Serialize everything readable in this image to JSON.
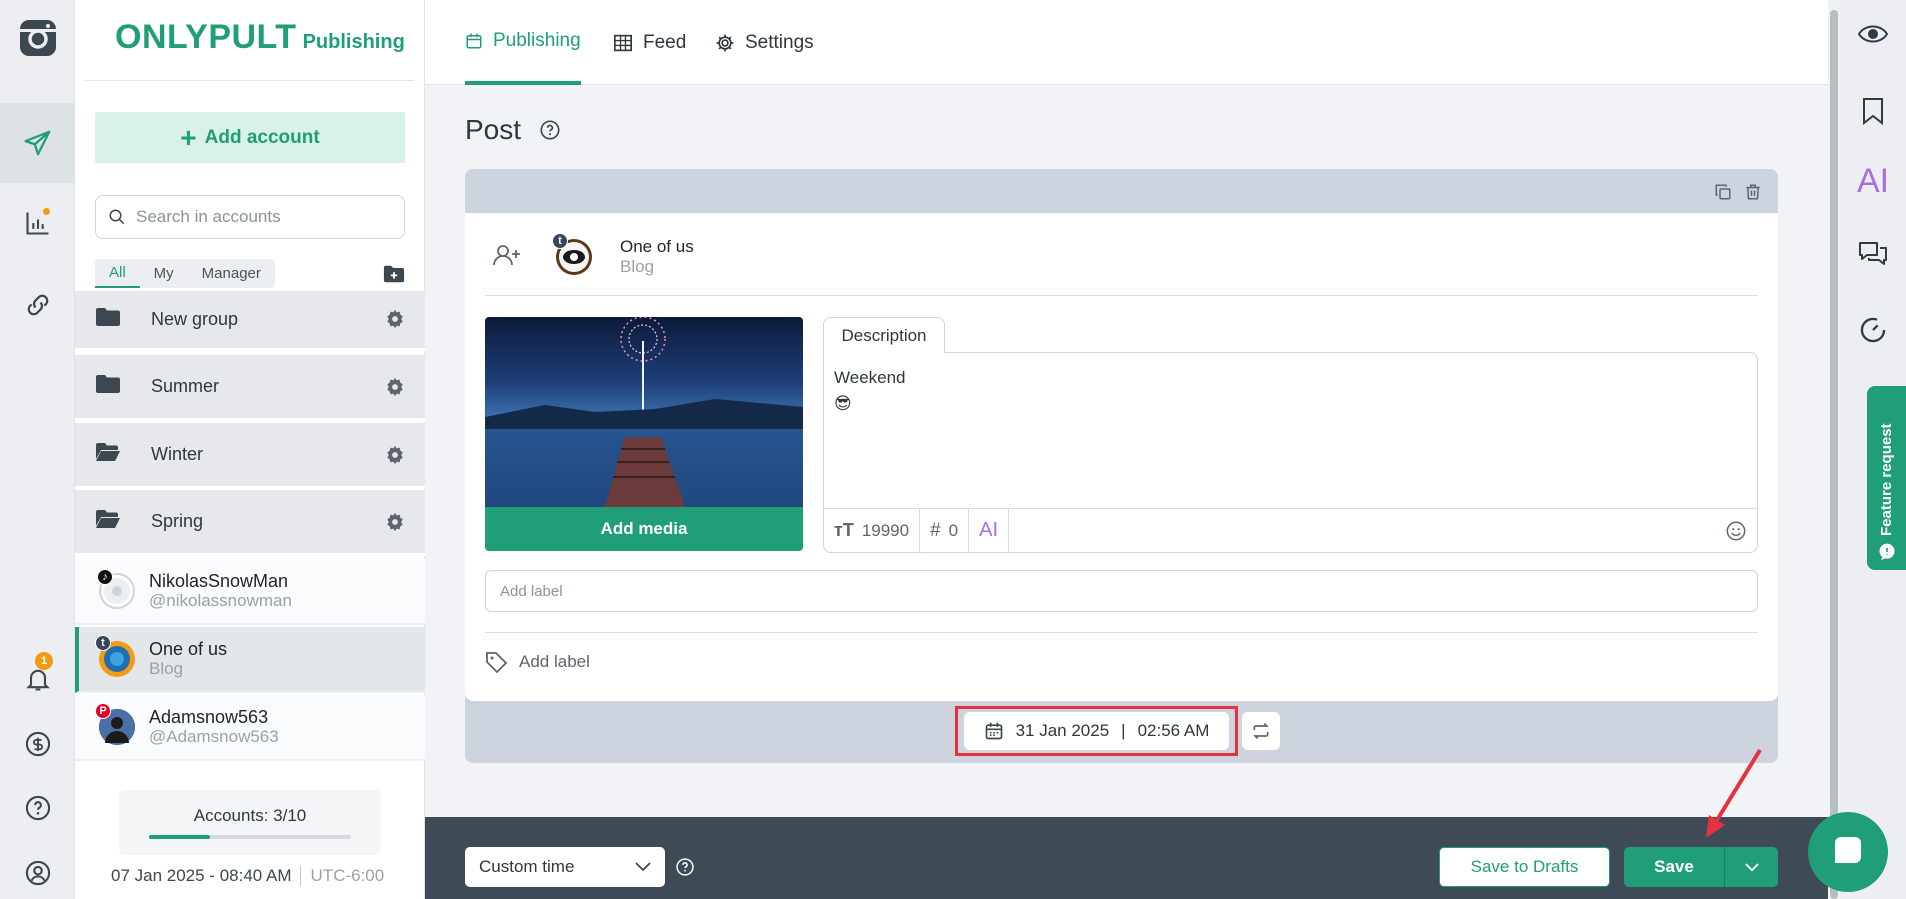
{
  "brand": {
    "name": "ONLYPULT",
    "product": "Publishing"
  },
  "rail": {
    "notifications_count": "1"
  },
  "accounts_panel": {
    "add_account_label": "Add account",
    "search_placeholder": "Search in accounts",
    "filters": [
      "All",
      "My",
      "Manager"
    ],
    "selected_filter": "All",
    "groups": [
      {
        "name": "New group"
      },
      {
        "name": "Summer"
      },
      {
        "name": "Winter"
      },
      {
        "name": "Spring"
      }
    ],
    "accounts": [
      {
        "name": "NikolasSnowMan",
        "handle": "@nikolassnowman",
        "network": "tiktok",
        "net_letter": "♪"
      },
      {
        "name": "One of us",
        "handle": "Blog",
        "network": "tumblr",
        "net_letter": "t",
        "selected": true
      },
      {
        "name": "Adamsnow563",
        "handle": "@Adamsnow563",
        "network": "pinterest",
        "net_letter": "P"
      }
    ],
    "accounts_count": "Accounts: 3/10",
    "accounts_used_fraction": 0.3,
    "datetime": "07 Jan 2025 - 08:40 AM",
    "timezone": "UTC-6:00"
  },
  "topnav": {
    "tabs": [
      {
        "label": "Publishing",
        "icon": "calendar-icon",
        "active": true
      },
      {
        "label": "Feed",
        "icon": "grid-icon",
        "active": false
      },
      {
        "label": "Settings",
        "icon": "gear-icon",
        "active": false
      }
    ]
  },
  "post": {
    "title": "Post",
    "account": {
      "name": "One of us",
      "type": "Blog",
      "network": "tumblr"
    },
    "add_media_label": "Add media",
    "description_tab": "Description",
    "description_text": "Weekend",
    "description_emoji": "😎",
    "char_count": "19990",
    "hashtag_count": "0",
    "ai_label": "AI",
    "label_placeholder": "Add label",
    "add_label_text": "Add label",
    "date": "31 Jan 2025",
    "time": "02:56 AM"
  },
  "bottom_bar": {
    "time_mode": "Custom time",
    "save_drafts_label": "Save to Drafts",
    "save_label": "Save"
  },
  "right_rail": {
    "ai_label": "AI",
    "feature_request_label": "Feature request"
  },
  "colors": {
    "brand_green": "#1f9e77",
    "highlight_red": "#e5323e",
    "ai_purple": "#a86ee0",
    "badge_orange": "#f39c12"
  }
}
